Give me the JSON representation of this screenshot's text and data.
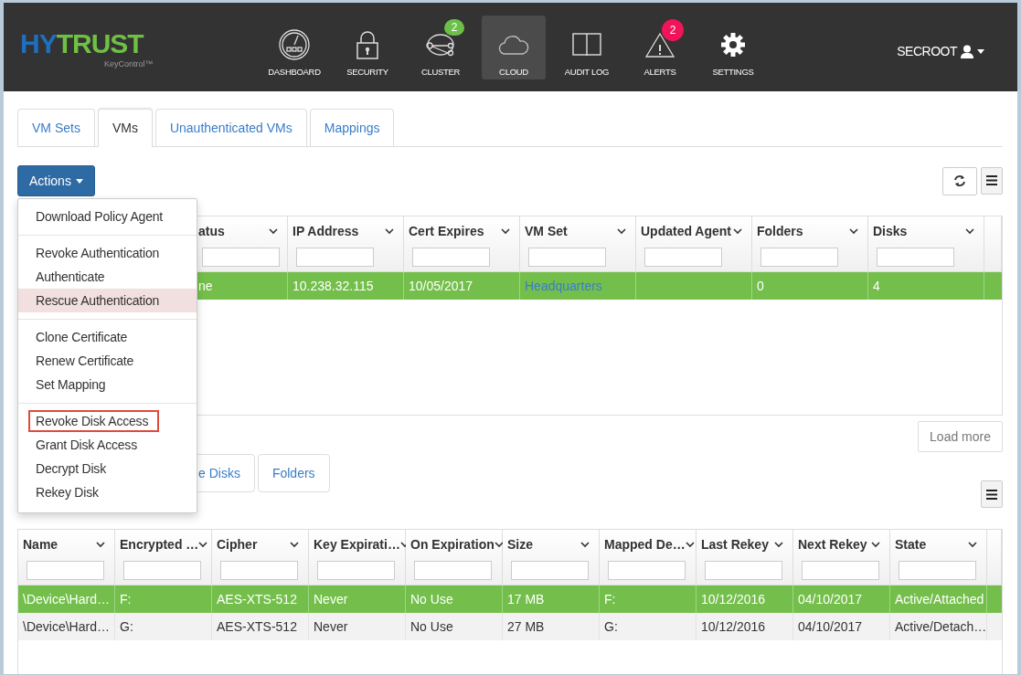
{
  "brand": {
    "first": "HY",
    "second": "TRUST",
    "product": "KeyControl™"
  },
  "nav": [
    {
      "label": "DASHBOARD",
      "kind": "gauge",
      "selected": false
    },
    {
      "label": "SECURITY",
      "kind": "lock",
      "selected": false
    },
    {
      "label": "CLUSTER",
      "kind": "cluster",
      "selected": false,
      "badge": "2"
    },
    {
      "label": "CLOUD",
      "kind": "cloud",
      "selected": true
    },
    {
      "label": "AUDIT LOG",
      "kind": "book",
      "selected": false
    },
    {
      "label": "ALERTS",
      "kind": "alert",
      "selected": false,
      "badge": "2"
    },
    {
      "label": "SETTINGS",
      "kind": "gear",
      "selected": false
    }
  ],
  "user": "SECROOT",
  "tabs": [
    {
      "label": "VM Sets",
      "selected": false
    },
    {
      "label": "VMs",
      "selected": true
    },
    {
      "label": "Unauthenticated VMs",
      "selected": false
    },
    {
      "label": "Mappings",
      "selected": false
    }
  ],
  "actions": {
    "label": "Actions",
    "menu": [
      [
        {
          "label": "Download Policy Agent",
          "kind": "download",
          "highlighted": false,
          "outlined": false
        }
      ],
      [
        {
          "label": "Revoke Authentication",
          "kind": "plain",
          "highlighted": false,
          "outlined": false
        },
        {
          "label": "Authenticate",
          "kind": "plain",
          "highlighted": false,
          "outlined": false
        },
        {
          "label": "Rescue Authentication",
          "kind": "plain",
          "highlighted": true,
          "outlined": false
        }
      ],
      [
        {
          "label": "Clone Certificate",
          "kind": "plain",
          "highlighted": false,
          "outlined": false
        },
        {
          "label": "Renew Certificate",
          "kind": "plain",
          "highlighted": false,
          "outlined": false
        },
        {
          "label": "Set Mapping",
          "kind": "plain",
          "highlighted": false,
          "outlined": false
        }
      ],
      [
        {
          "label": "Revoke Disk Access",
          "kind": "plain",
          "highlighted": false,
          "outlined": true
        },
        {
          "label": "Grant Disk Access",
          "kind": "plain",
          "highlighted": false,
          "outlined": false
        },
        {
          "label": "Decrypt Disk",
          "kind": "plain",
          "highlighted": false,
          "outlined": false
        },
        {
          "label": "Rekey Disk",
          "kind": "plain",
          "highlighted": false,
          "outlined": false
        }
      ]
    ]
  },
  "vm_table": {
    "columns": [
      "atus",
      "IP Address",
      "Cert Expires",
      "VM Set",
      "Updated Agent",
      "Folders",
      "Disks"
    ],
    "rows": [
      {
        "selected": true,
        "cells": [
          "ne",
          "10.238.32.115",
          "10/05/2017",
          {
            "text": "Headquarters",
            "kind": "link"
          },
          null,
          "0",
          "4"
        ]
      }
    ]
  },
  "load_more": "Load more",
  "disk_tabs": [
    {
      "label": "e Disks",
      "selected": false
    },
    {
      "label": "Folders",
      "selected": false
    }
  ],
  "disk_table": {
    "columns": [
      "Name",
      "Encrypted …",
      "Cipher",
      "Key Expirati…",
      "On Expiration",
      "Size",
      "Mapped De…",
      "Last Rekey",
      "Next Rekey",
      "State"
    ],
    "rows": [
      {
        "selected": true,
        "cells": [
          "\\Device\\Hard…",
          "F:",
          "AES-XTS-512",
          "Never",
          "No Use",
          "17 MB",
          "F:",
          "10/12/2016",
          "04/10/2017",
          "Active/Attached"
        ]
      },
      {
        "selected": false,
        "cells": [
          "\\Device\\Hard…",
          "G:",
          "AES-XTS-512",
          "Never",
          "No Use",
          "27 MB",
          "G:",
          "10/12/2016",
          "04/10/2017",
          "Active/Detach…"
        ]
      }
    ]
  }
}
